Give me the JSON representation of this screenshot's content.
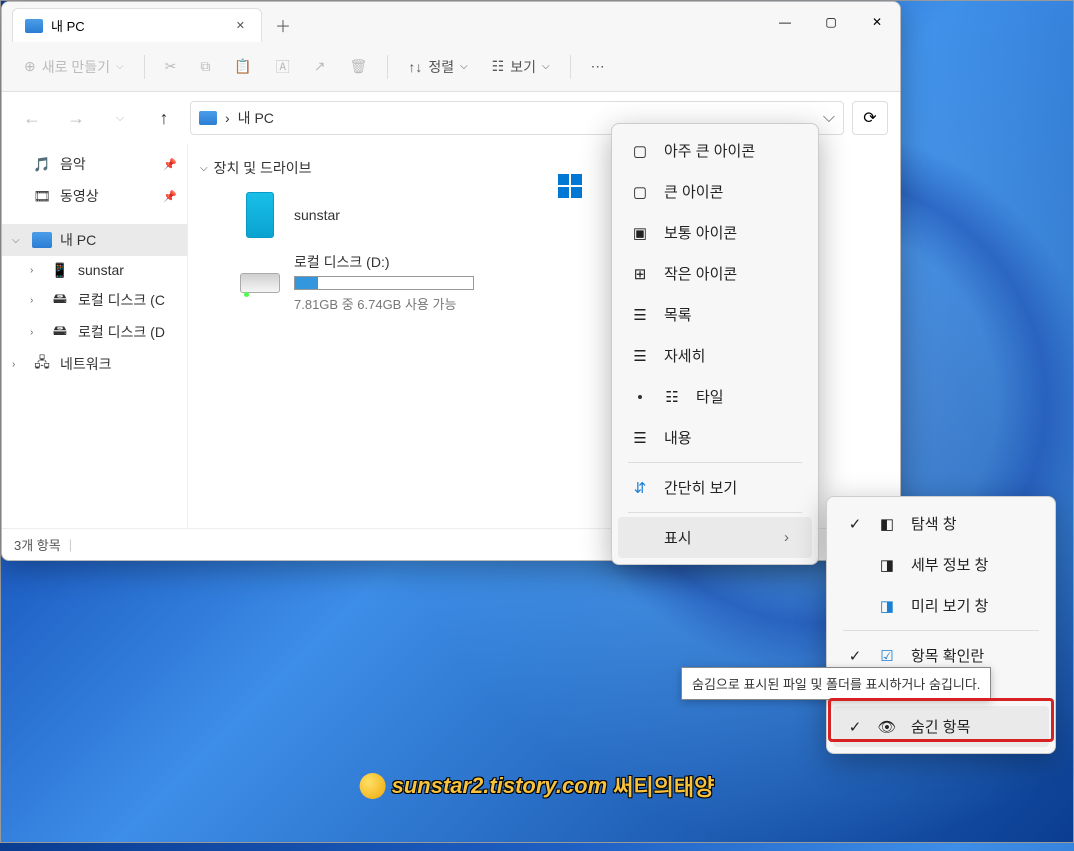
{
  "titlebar": {
    "tab_title": "내 PC"
  },
  "toolbar": {
    "new": "새로 만들기",
    "sort": "정렬",
    "view": "보기"
  },
  "addressbar": {
    "sep": "›",
    "path": "내 PC"
  },
  "sidebar": {
    "music": "음악",
    "videos": "동영상",
    "thispc": "내 PC",
    "sunstar": "sunstar",
    "diskC": "로컬 디스크 (C",
    "diskD": "로컬 디스크 (D",
    "network": "네트워크"
  },
  "content": {
    "group": "장치 및 드라이브",
    "sunstar": "sunstar",
    "diskD_name": "로컬 디스크 (D:)",
    "diskD_sub": "7.81GB 중 6.74GB 사용 가능"
  },
  "statusbar": {
    "items": "3개 항목"
  },
  "viewmenu": {
    "extra_large": "아주 큰 아이콘",
    "large": "큰 아이콘",
    "medium": "보통 아이콘",
    "small": "작은 아이콘",
    "list": "목록",
    "details": "자세히",
    "tiles": "타일",
    "content": "내용",
    "compact": "간단히 보기",
    "show": "표시"
  },
  "showmenu": {
    "nav_pane": "탐색 창",
    "details_pane": "세부 정보 창",
    "preview_pane": "미리 보기 창",
    "item_check": "항목 확인란",
    "hidden_items": "숨긴 항목"
  },
  "tooltip": "숨김으로 표시된 파일 및 폴더를 표시하거나 숨깁니다.",
  "watermark": {
    "url": "sunstar2.tistory.com",
    "title": "써티의태양"
  }
}
